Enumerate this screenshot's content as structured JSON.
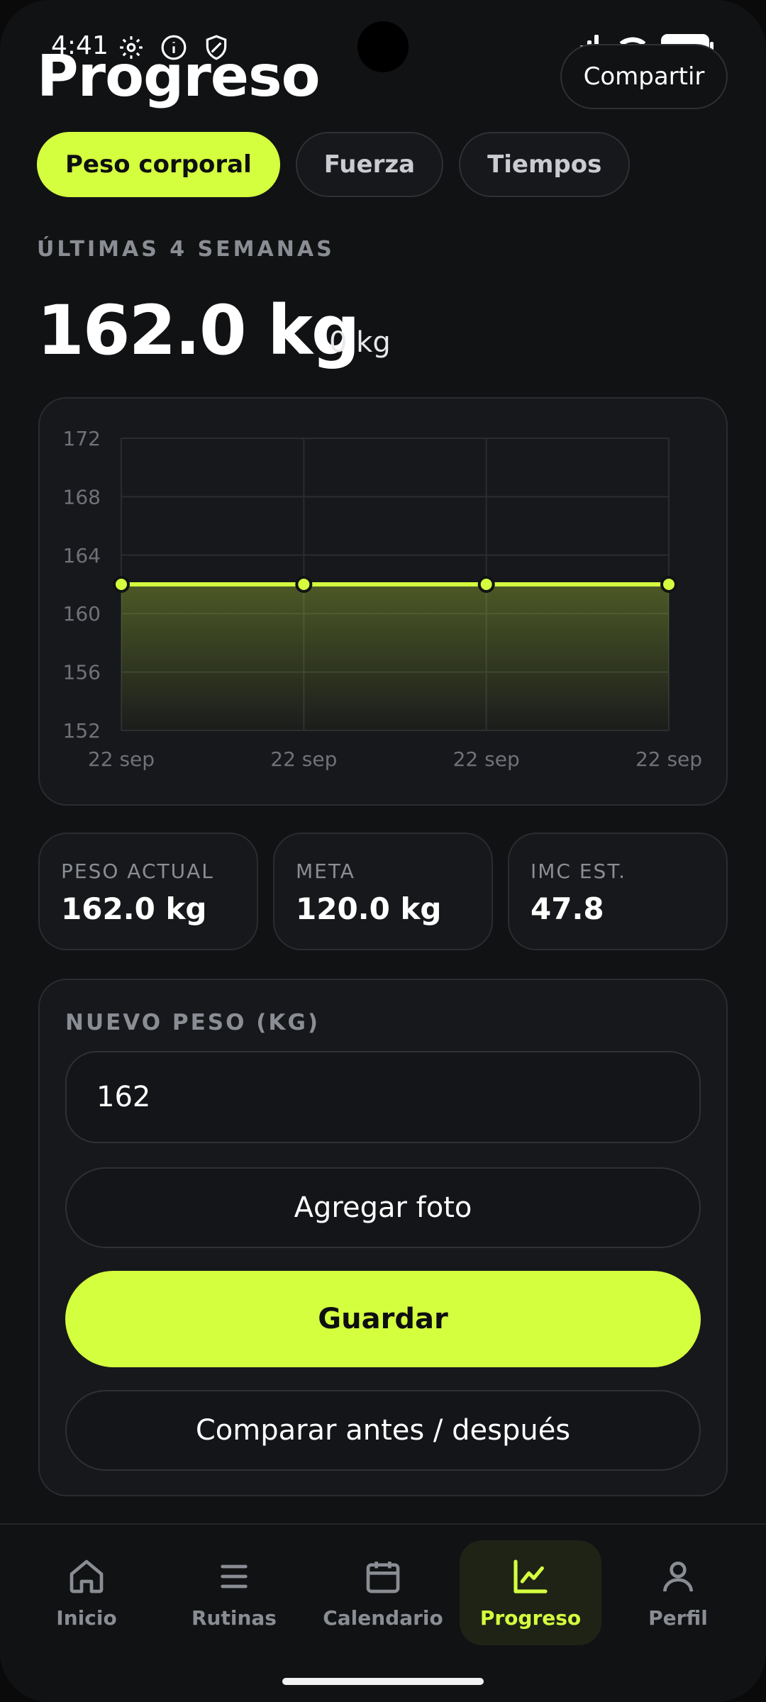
{
  "status": {
    "time": "4:41"
  },
  "header": {
    "title": "Progreso",
    "share_label": "Compartir"
  },
  "tabs": [
    {
      "label": "Peso corporal",
      "active": true
    },
    {
      "label": "Fuerza",
      "active": false
    },
    {
      "label": "Tiempos",
      "active": false
    }
  ],
  "summary": {
    "period_label": "ÚLTIMAS 4 SEMANAS",
    "current": "162.0 kg",
    "change": "0 kg"
  },
  "chart_data": {
    "type": "area",
    "x": [
      "22 sep",
      "22 sep",
      "22 sep",
      "22 sep"
    ],
    "values": [
      162,
      162,
      162,
      162
    ],
    "yticks": [
      172,
      168,
      164,
      160,
      156,
      152
    ],
    "ylim": [
      152,
      172
    ],
    "grid": true,
    "colors": {
      "line": "#d4ff3f",
      "grid": "#2a2c30"
    }
  },
  "stats": [
    {
      "label": "PESO ACTUAL",
      "value": "162.0 kg"
    },
    {
      "label": "META",
      "value": "120.0 kg"
    },
    {
      "label": "IMC EST.",
      "value": "47.8"
    }
  ],
  "form": {
    "label": "NUEVO PESO (KG)",
    "input_value": "162",
    "add_photo_label": "Agregar foto",
    "save_label": "Guardar",
    "compare_label": "Comparar antes / después"
  },
  "nav": [
    {
      "label": "Inicio",
      "icon": "home-icon",
      "active": false
    },
    {
      "label": "Rutinas",
      "icon": "list-icon",
      "active": false
    },
    {
      "label": "Calendario",
      "icon": "calendar-icon",
      "active": false
    },
    {
      "label": "Progreso",
      "icon": "chart-icon",
      "active": true
    },
    {
      "label": "Perfil",
      "icon": "user-icon",
      "active": false
    }
  ],
  "colors": {
    "accent": "#d4ff3f",
    "background": "#111214",
    "card": "#17181b"
  }
}
